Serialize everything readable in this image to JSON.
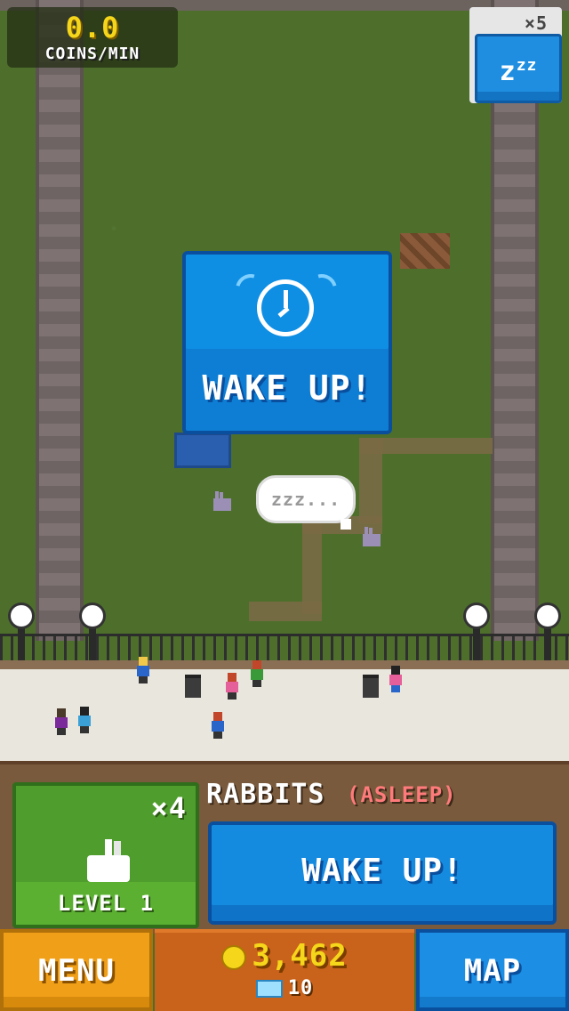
{
  "hud": {
    "coins_per_min_value": "0.0",
    "coins_per_min_unit": "COINS/MIN",
    "sleep_multiplier": "×5",
    "sleep_button_label": "z",
    "sleep_button_sup": "zz"
  },
  "popup": {
    "icon": "alarm-clock-icon",
    "label": "WAKE UP!"
  },
  "speech_bubble": "zzz...",
  "animal": {
    "name": "RABBITS",
    "status": "(ASLEEP)",
    "multiplier": "×4",
    "level_label": "LEVEL 1",
    "wake_button_label": "WAKE UP!"
  },
  "footer": {
    "menu_label": "MENU",
    "map_label": "MAP",
    "gold": "3,462",
    "gems": "10"
  },
  "colors": {
    "accent_blue": "#158be0",
    "gold": "#f5d61a",
    "menu_orange": "#f0a018",
    "grass": "#4d6f2b",
    "status_red": "#ff7b7b"
  }
}
